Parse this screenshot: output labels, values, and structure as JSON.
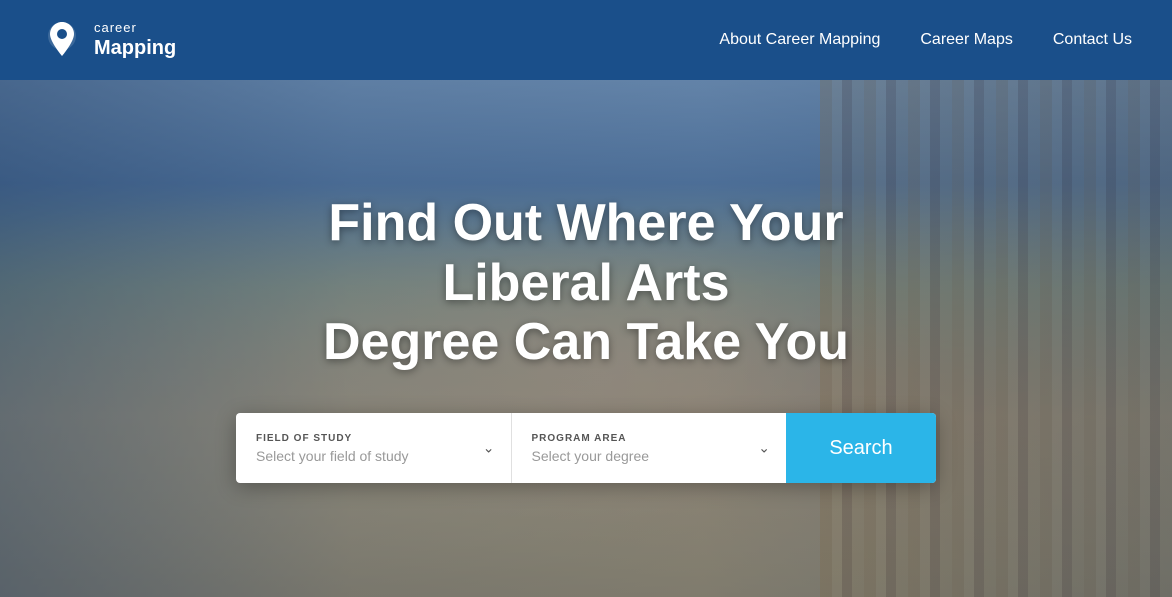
{
  "header": {
    "logo_line1": "career",
    "logo_line2": "Mapping",
    "nav_items": [
      {
        "label": "About Career Mapping",
        "href": "#"
      },
      {
        "label": "Career Maps",
        "href": "#"
      },
      {
        "label": "Contact Us",
        "href": "#"
      }
    ]
  },
  "hero": {
    "title_line1": "Find Out Where Your Liberal Arts",
    "title_line2": "Degree Can Take You",
    "field_of_study_label": "FIELD OF STUDY",
    "field_of_study_placeholder": "Select your field of study",
    "program_area_label": "PROGRAM AREA",
    "program_area_placeholder": "Select your degree",
    "search_button_label": "Search"
  }
}
